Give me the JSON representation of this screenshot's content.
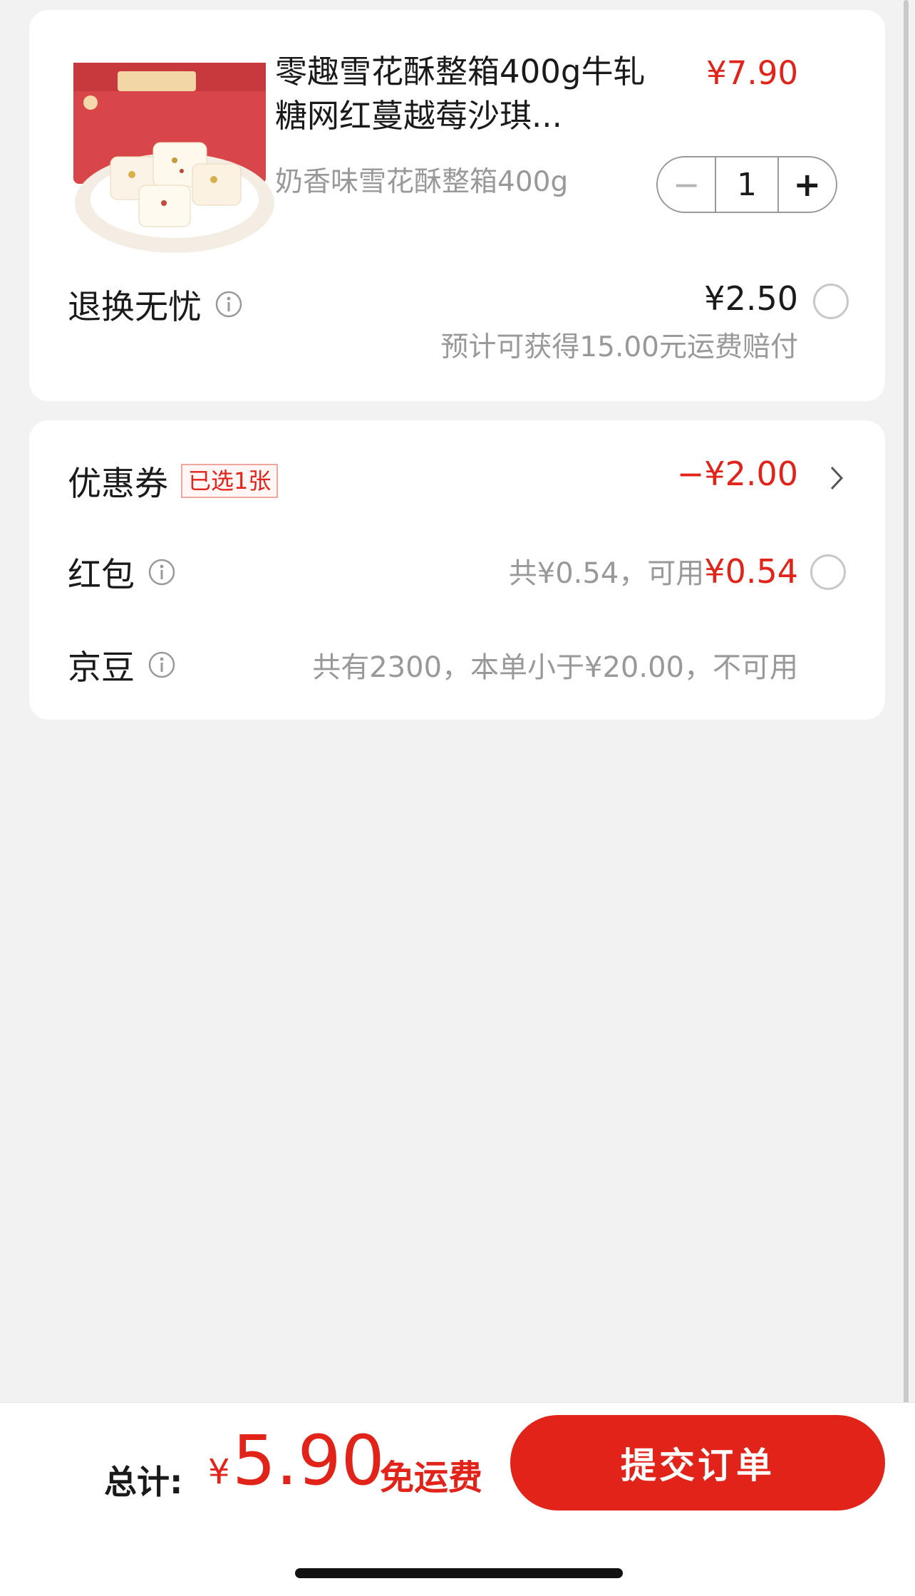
{
  "product": {
    "title": "零趣雪花酥整箱400g牛轧糖网红蔓越莓沙琪...",
    "price": "¥7.90",
    "spec": "奶香味雪花酥整箱400g",
    "quantity": "1",
    "minus_label": "−",
    "plus_label": "+",
    "image_icon": "product-image"
  },
  "return_service": {
    "label": "退换无忧",
    "price": "¥2.50",
    "note": "预计可获得15.00元运费赔付"
  },
  "coupon": {
    "label": "优惠券",
    "badge": "已选1张",
    "value": "−¥2.00"
  },
  "red_packet": {
    "label": "红包",
    "total": "共¥0.54，可用",
    "usable": "¥0.54"
  },
  "jd_beans": {
    "label": "京豆",
    "note": "共有2300，本单小于¥20.00，不可用"
  },
  "footer": {
    "total_label": "总计:",
    "currency": "¥",
    "amount": "5.90",
    "shipping": "免运费",
    "submit_label": "提交订单"
  },
  "colors": {
    "accent": "#e2231a",
    "muted": "#999999",
    "background": "#f2f2f2"
  }
}
